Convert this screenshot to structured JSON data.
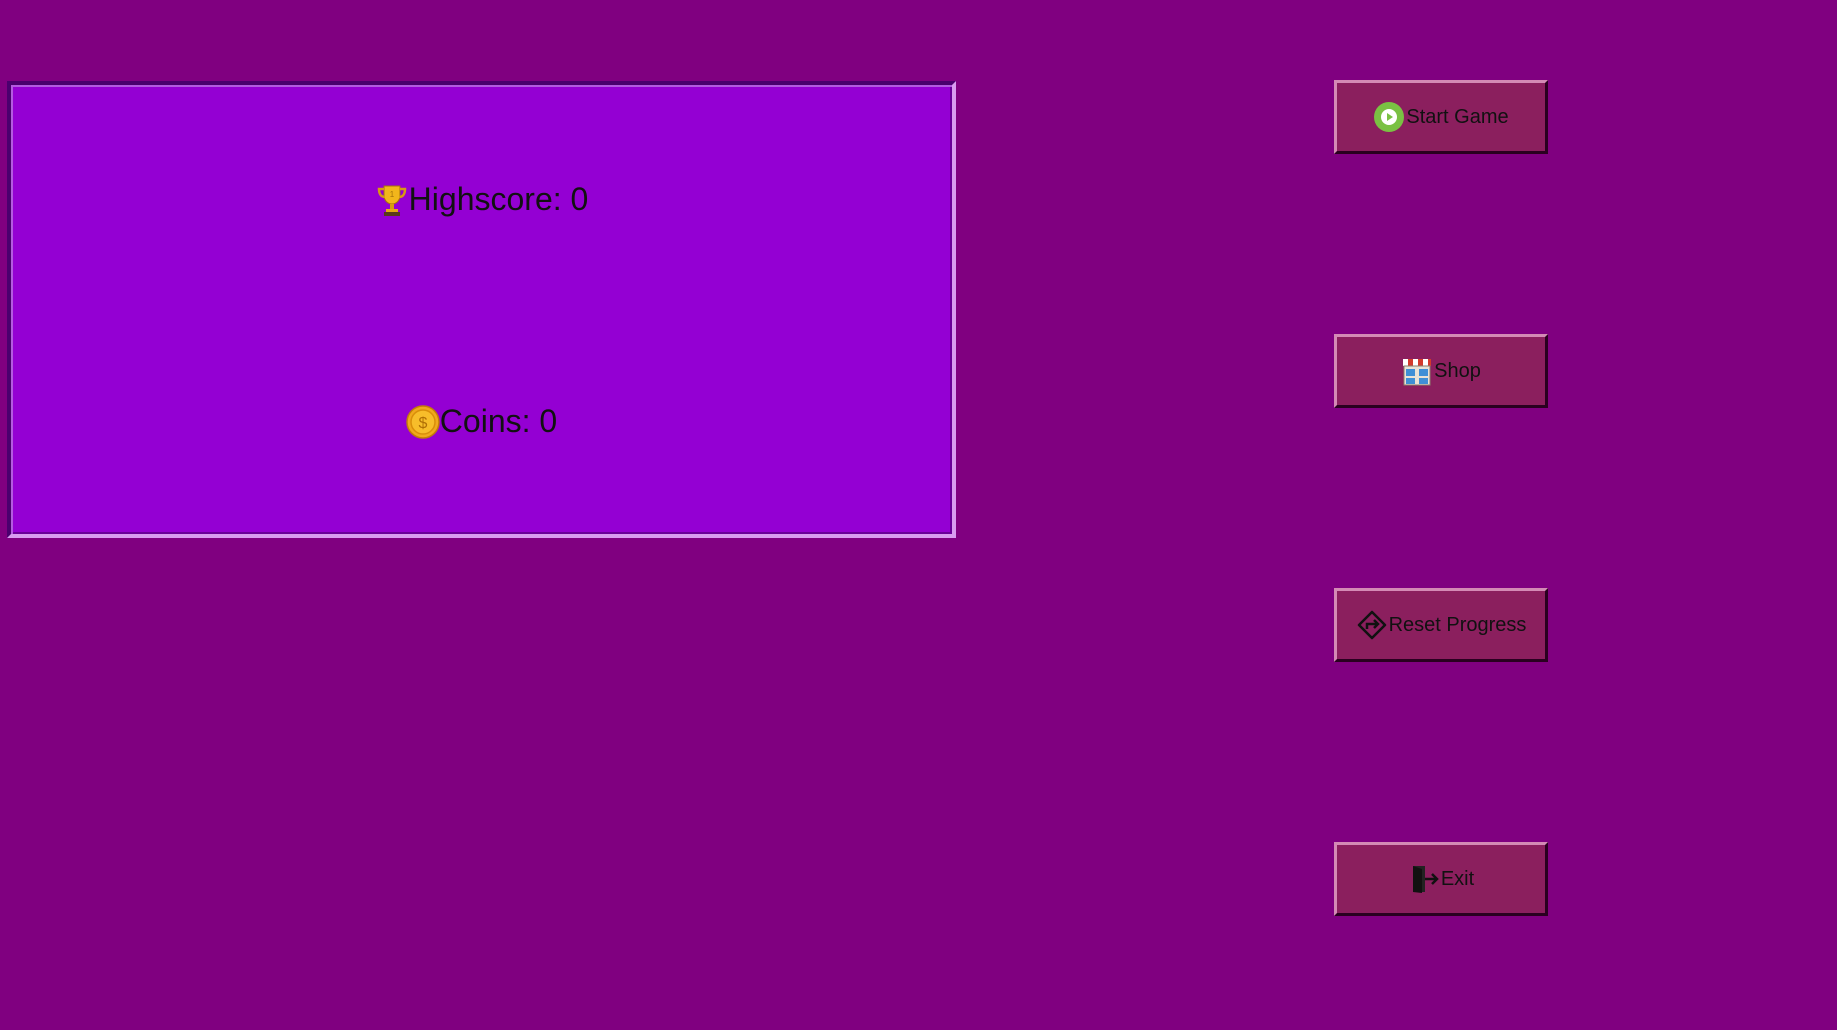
{
  "stats": {
    "highscore_label": "Highscore: 0",
    "highscore_icon": "trophy-icon",
    "coins_label": "Coins: 0",
    "coins_icon": "coin-icon"
  },
  "menu": {
    "start_label": "Start Game",
    "start_icon": "play-icon",
    "shop_label": "Shop",
    "shop_icon": "store-icon",
    "reset_label": "Reset Progress",
    "reset_icon": "reset-icon",
    "exit_label": "Exit",
    "exit_icon": "exit-door-icon"
  },
  "colors": {
    "background": "#800080",
    "panel": "#9400D3",
    "button": "#8b1f5e"
  }
}
